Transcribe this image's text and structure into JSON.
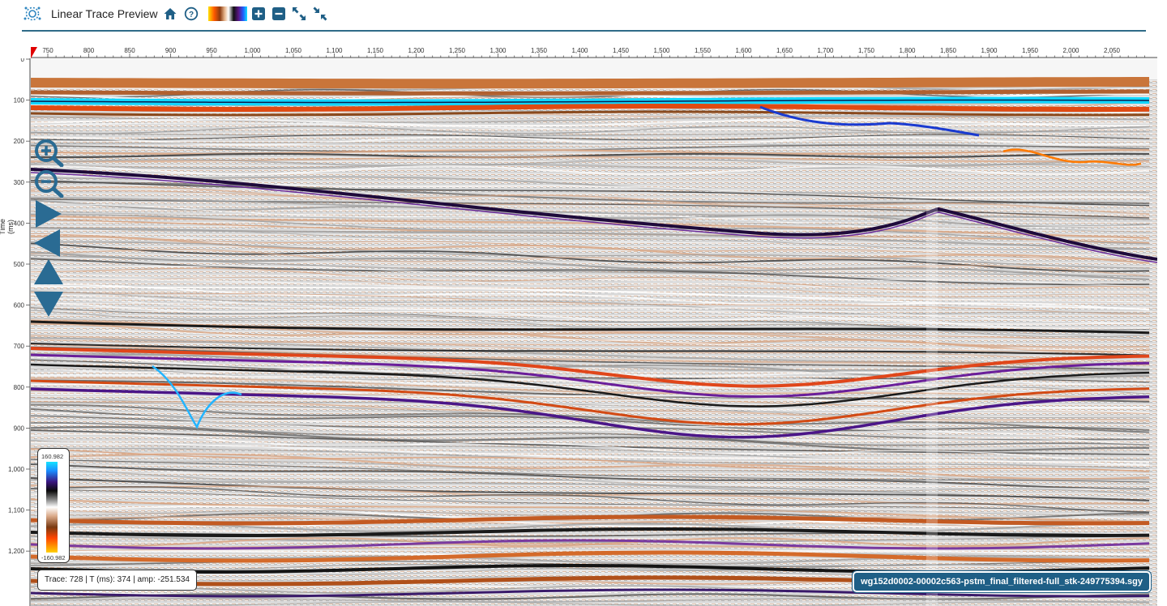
{
  "toolbar": {
    "title": "Linear Trace Preview",
    "buttons": [
      {
        "name": "home-button",
        "icon": "home-icon"
      },
      {
        "name": "help-button",
        "icon": "help-circle-icon"
      },
      {
        "name": "colormap-button",
        "icon": "colormap-swatch-icon"
      },
      {
        "name": "zoom-in-button",
        "icon": "plus-square-icon"
      },
      {
        "name": "zoom-out-button",
        "icon": "minus-square-icon"
      },
      {
        "name": "expand-button",
        "icon": "expand-arrows-icon"
      },
      {
        "name": "collapse-button",
        "icon": "collapse-arrows-icon"
      }
    ],
    "accent": "#1f5f86"
  },
  "x_axis": {
    "ticks": [
      "750",
      "800",
      "850",
      "900",
      "950",
      "1,000",
      "1,050",
      "1,100",
      "1,150",
      "1,200",
      "1,250",
      "1,300",
      "1,350",
      "1,400",
      "1,450",
      "1,500",
      "1,550",
      "1,600",
      "1,650",
      "1,700",
      "1,750",
      "1,800",
      "1,850",
      "1,900",
      "1,950",
      "2,000",
      "2,050"
    ]
  },
  "y_axis": {
    "title": "Time (ms)",
    "ticks": [
      "0",
      "100",
      "200",
      "300",
      "400",
      "500",
      "600",
      "700",
      "800",
      "900",
      "1,000",
      "1,100",
      "1,200"
    ]
  },
  "nav": {
    "items": [
      "zoom-in-magnifier-icon",
      "zoom-out-magnifier-icon",
      "pan-right-arrow-icon",
      "pan-left-arrow-icon",
      "pan-up-arrow-icon",
      "pan-down-arrow-icon"
    ],
    "color": "#2a6b93"
  },
  "colorbar": {
    "max": "160.982",
    "min": "-160.982"
  },
  "readout": {
    "text": "Trace: 728 | T (ms): 374 | amp: -251.534"
  },
  "file": {
    "name": "wg152d0002-00002c563-pstm_final_filtered-full_stk-249775394.sgy"
  }
}
